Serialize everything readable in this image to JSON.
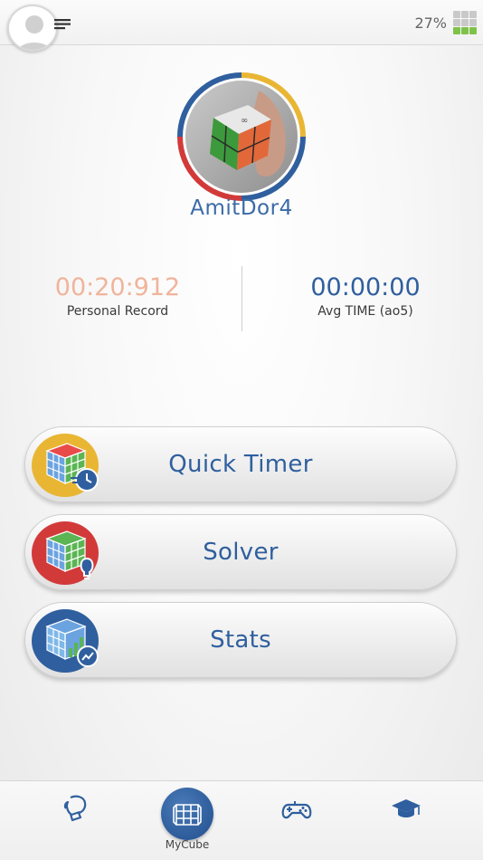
{
  "header": {
    "battery_percent": "27%",
    "menu_icon": "hamburger-menu-icon",
    "avatar_icon": "user-avatar-icon",
    "battery_icon": "cube-battery-icon"
  },
  "profile": {
    "username": "AmitDor4"
  },
  "stats": {
    "personal_record_value": "00:20:912",
    "personal_record_label": "Personal Record",
    "avg_time_value": "00:00:00",
    "avg_time_label": "Avg TIME (ao5)"
  },
  "actions": [
    {
      "label": "Quick Timer",
      "icon": "quick-timer-cube-icon",
      "color": "#e9b634"
    },
    {
      "label": "Solver",
      "icon": "solver-cube-icon",
      "color": "#d23a3a"
    },
    {
      "label": "Stats",
      "icon": "stats-cube-icon",
      "color": "#2f5f9e"
    }
  ],
  "bottom_nav": {
    "items": [
      {
        "label": "",
        "icon": "boxing-glove-icon"
      },
      {
        "label": "MyCube",
        "icon": "cube-grid-icon"
      },
      {
        "label": "",
        "icon": "gamepad-icon"
      },
      {
        "label": "",
        "icon": "graduation-cap-icon"
      }
    ]
  },
  "colors": {
    "primary_blue": "#2f5f9e",
    "record_orange": "#f0b49b",
    "ring_yellow": "#e9b634",
    "ring_blue": "#2f5f9e",
    "ring_red": "#d23a3a"
  }
}
